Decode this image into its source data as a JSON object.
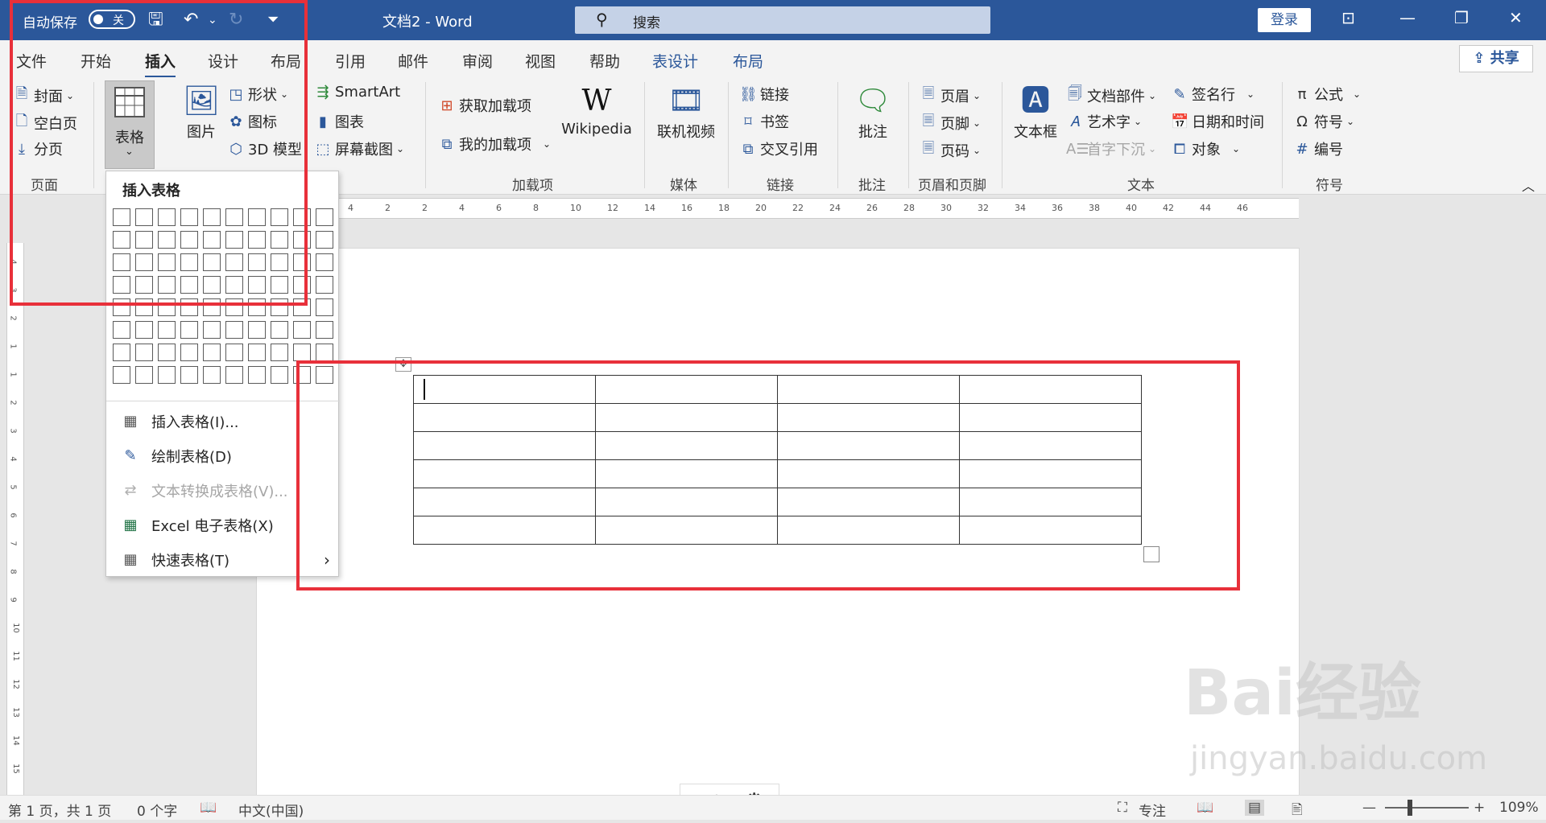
{
  "titlebar": {
    "autosave_label": "自动保存",
    "autosave_state": "关",
    "doc_title": "文档2  -  Word",
    "search_placeholder": "搜索",
    "login_label": "登录"
  },
  "tabs": [
    {
      "label": "文件"
    },
    {
      "label": "开始"
    },
    {
      "label": "插入"
    },
    {
      "label": "设计"
    },
    {
      "label": "布局"
    },
    {
      "label": "引用"
    },
    {
      "label": "邮件"
    },
    {
      "label": "审阅"
    },
    {
      "label": "视图"
    },
    {
      "label": "帮助"
    },
    {
      "label": "表设计"
    },
    {
      "label": "布局"
    }
  ],
  "share_label": "共享",
  "ribbon": {
    "pages": {
      "cover": "封面",
      "blank": "空白页",
      "break": "分页",
      "group": "页面"
    },
    "table": {
      "label": "表格"
    },
    "illustrations": {
      "picture": "图片",
      "shapes": "形状",
      "icons": "图标",
      "model3d": "3D 模型",
      "smartart": "SmartArt",
      "chart": "图表",
      "screenshot": "屏幕截图"
    },
    "addins": {
      "get": "获取加载项",
      "my": "我的加载项",
      "wikipedia": "Wikipedia",
      "group": "加载项"
    },
    "media": {
      "video": "联机视频",
      "group": "媒体"
    },
    "links": {
      "link": "链接",
      "bookmark": "书签",
      "crossref": "交叉引用",
      "group": "链接"
    },
    "comments": {
      "comment": "批注",
      "group": "批注"
    },
    "headerfooter": {
      "header": "页眉",
      "footer": "页脚",
      "pagenum": "页码",
      "group": "页眉和页脚"
    },
    "text": {
      "textbox": "文本框",
      "parts": "文档部件",
      "wordart": "艺术字",
      "dropcap": "首字下沉",
      "signature": "签名行",
      "datetime": "日期和时间",
      "object": "对象",
      "group": "文本"
    },
    "symbols": {
      "equation": "公式",
      "symbol": "符号",
      "number": "编号",
      "group": "符号"
    }
  },
  "dropdown": {
    "header": "插入表格",
    "items": [
      {
        "label": "插入表格(I)..."
      },
      {
        "label": "绘制表格(D)"
      },
      {
        "label": "文本转换成表格(V)..."
      },
      {
        "label": "Excel 电子表格(X)"
      },
      {
        "label": "快速表格(T)"
      }
    ]
  },
  "ruler_ticks": [
    "4",
    "2",
    "2",
    "4",
    "6",
    "8",
    "10",
    "12",
    "14",
    "16",
    "18",
    "20",
    "22",
    "24",
    "26",
    "28",
    "30",
    "32",
    "34",
    "36",
    "38",
    "40",
    "42",
    "44",
    "46"
  ],
  "vruler_ticks": [
    "4",
    "3",
    "2",
    "1",
    "1",
    "2",
    "3",
    "4",
    "5",
    "6",
    "7",
    "8",
    "9",
    "10",
    "11",
    "12",
    "13",
    "14",
    "15"
  ],
  "statusbar": {
    "page": "第 1 页，共 1 页",
    "words": "0 个字",
    "lang": "中文(中国)",
    "focus": "专注",
    "zoom": "109%"
  },
  "ime": {
    "mode": "中"
  },
  "watermark": {
    "main": "Bai经验",
    "url": "jingyan.baidu.com"
  }
}
